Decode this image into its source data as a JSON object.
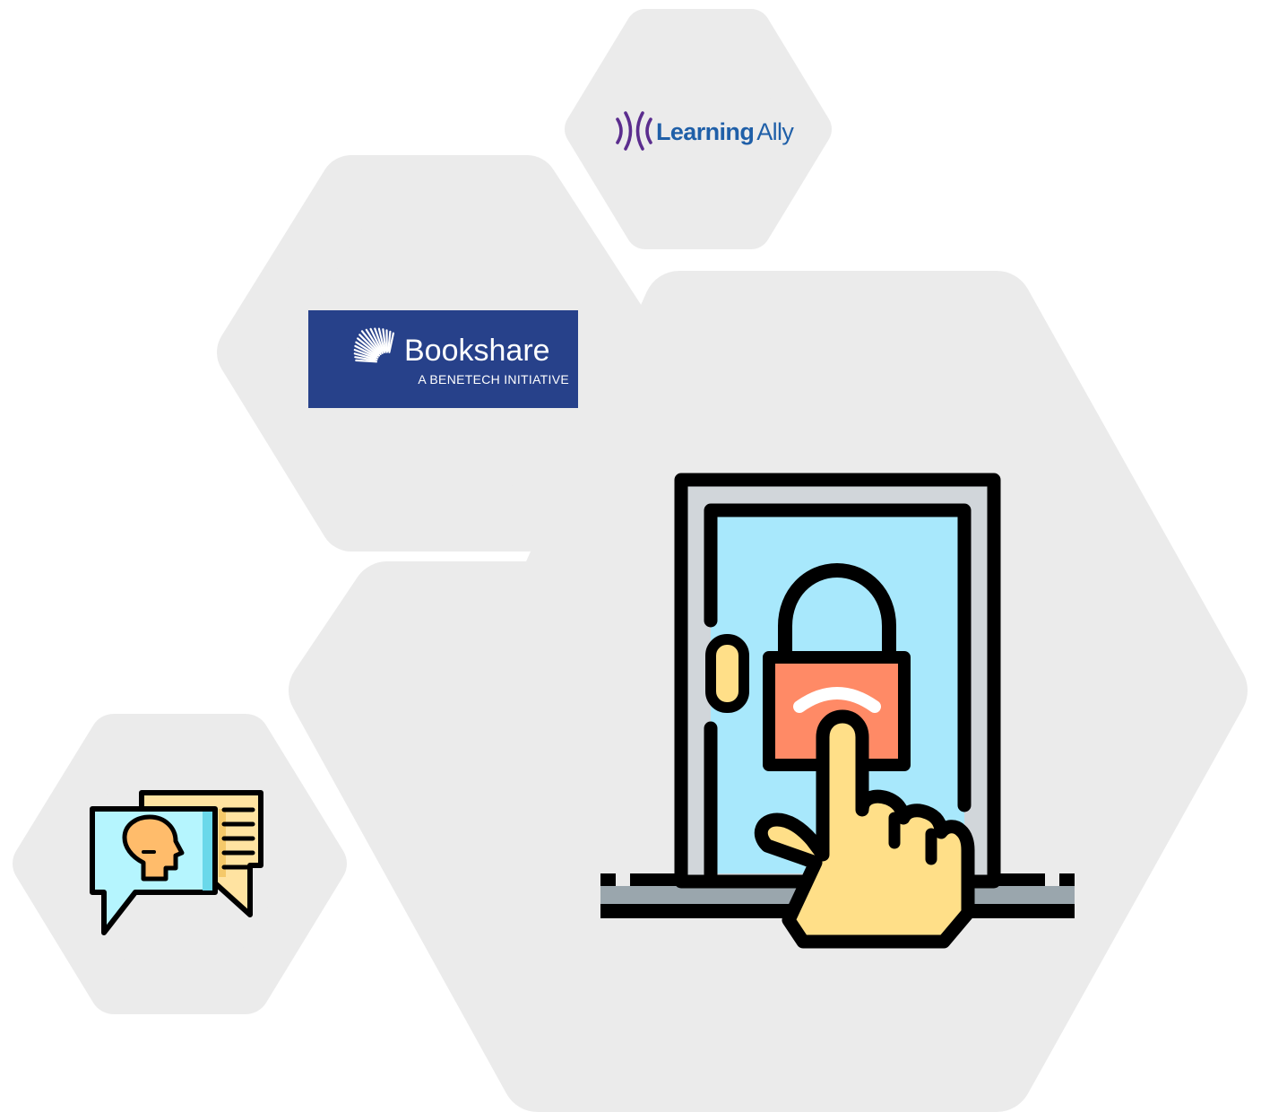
{
  "logos": {
    "learning_ally": {
      "word1": "Learning",
      "word2": "Ally",
      "mark": "sound-wave-icon",
      "text_color": "#1f5fa8",
      "mark_color": "#5b2d8e"
    },
    "bookshare": {
      "title": "Bookshare",
      "subtitle": "A BENETECH INITIATIVE",
      "background": "#27418a",
      "text_color": "#ffffff"
    }
  },
  "illustrations": {
    "chat": "chat-bubbles-person-icon",
    "door": "locked-door-touch-icon"
  },
  "colors": {
    "hexagon": "#ebebeb",
    "outline": "#000000",
    "door_glass": "#a8e8fc",
    "door_frame": "#d1d6da",
    "lock_body": "#ff8a66",
    "hand": "#ffdf88",
    "floor": "#9aa6ad",
    "chat_front": "#b5f5fe",
    "chat_back": "#ffe3a1",
    "chat_accent": "#6ad8ea",
    "head": "#ffbc6b"
  }
}
